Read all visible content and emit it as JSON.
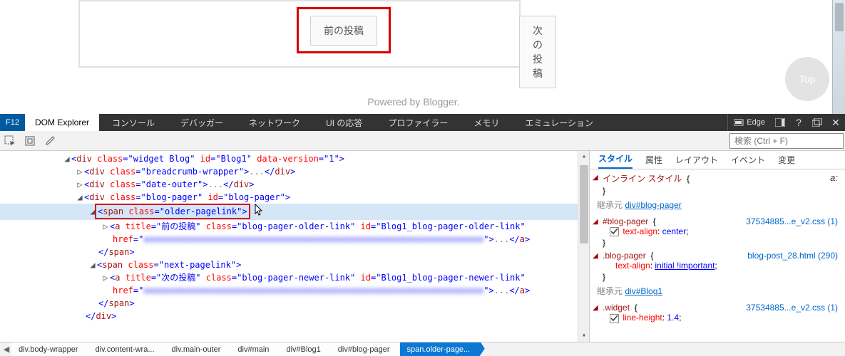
{
  "page": {
    "prev_label": "前の投稿",
    "next_label": "次の投稿",
    "powered": "Powered by Blogger.",
    "top_badge": "Top"
  },
  "devtools": {
    "f12": "F12",
    "tabs": {
      "dom": "DOM Explorer",
      "console": "コンソール",
      "debugger": "デバッガー",
      "network": "ネットワーク",
      "ui": "UI の応答",
      "profiler": "プロファイラー",
      "memory": "メモリ",
      "emulation": "エミュレーション"
    },
    "edge_label": "Edge",
    "search_placeholder": "検索 (Ctrl + F)"
  },
  "dom": {
    "l0": {
      "tag": "div",
      "class_attr": "class",
      "class_val": "widget Blog",
      "id_attr": "id",
      "id_val": "Blog1",
      "dv_attr": "data-version",
      "dv_val": "1"
    },
    "l1": {
      "tag": "div",
      "class_attr": "class",
      "class_val": "breadcrumb-wrapper",
      "dots": "...",
      "close": "div"
    },
    "l2": {
      "tag": "div",
      "class_attr": "class",
      "class_val": "date-outer",
      "dots": "...",
      "close": "div"
    },
    "l3": {
      "tag": "div",
      "class_attr": "class",
      "class_val": "blog-pager",
      "id_attr": "id",
      "id_val": "blog-pager"
    },
    "l4": {
      "tag": "span",
      "class_attr": "class",
      "class_val": "older-pagelink"
    },
    "l5": {
      "tag": "a",
      "title_attr": "title",
      "title_val": "前の投稿",
      "class_attr": "class",
      "class_val": "blog-pager-older-link",
      "id_attr": "id",
      "id_val": "Blog1_blog-pager-older-link",
      "href_attr": "href",
      "dots": "...",
      "close": "a"
    },
    "l6": {
      "close": "span"
    },
    "l7": {
      "tag": "span",
      "class_attr": "class",
      "class_val": "next-pagelink"
    },
    "l8": {
      "tag": "a",
      "title_attr": "title",
      "title_val": "次の投稿",
      "class_attr": "class",
      "class_val": "blog-pager-newer-link",
      "id_attr": "id",
      "id_val": "Blog1_blog-pager-newer-link",
      "href_attr": "href",
      "dots": "...",
      "close": "a"
    },
    "l9": {
      "close": "span"
    },
    "l10": {
      "close": "div"
    }
  },
  "styles": {
    "tabs": {
      "styles": "スタイル",
      "attrs": "属性",
      "layout": "レイアウト",
      "events": "イベント",
      "changes": "変更"
    },
    "inline_label": "インライン スタイル",
    "open_brace": "{",
    "close_brace": "}",
    "inherit1_label": "継承元",
    "inherit1_link": "div#blog-pager",
    "rule1": {
      "selector": "#blog-pager",
      "src": "37534885...e_v2.css (1)",
      "prop": "text-align",
      "val": "center"
    },
    "rule2": {
      "selector": ".blog-pager",
      "src": "blog-post_28.html (290)",
      "prop": "text-align",
      "val": "initial !important"
    },
    "inherit2_link": "div#Blog1",
    "rule3": {
      "selector": ".widget",
      "src": "37534885...e_v2.css (1)",
      "prop": "line-height",
      "val": "1.4"
    }
  },
  "breadcrumb": {
    "i0": "div.body-wrapper",
    "i1": "div.content-wra...",
    "i2": "div.main-outer",
    "i3": "div#main",
    "i4": "div#Blog1",
    "i5": "div#blog-pager",
    "i6": "span.older-page..."
  }
}
